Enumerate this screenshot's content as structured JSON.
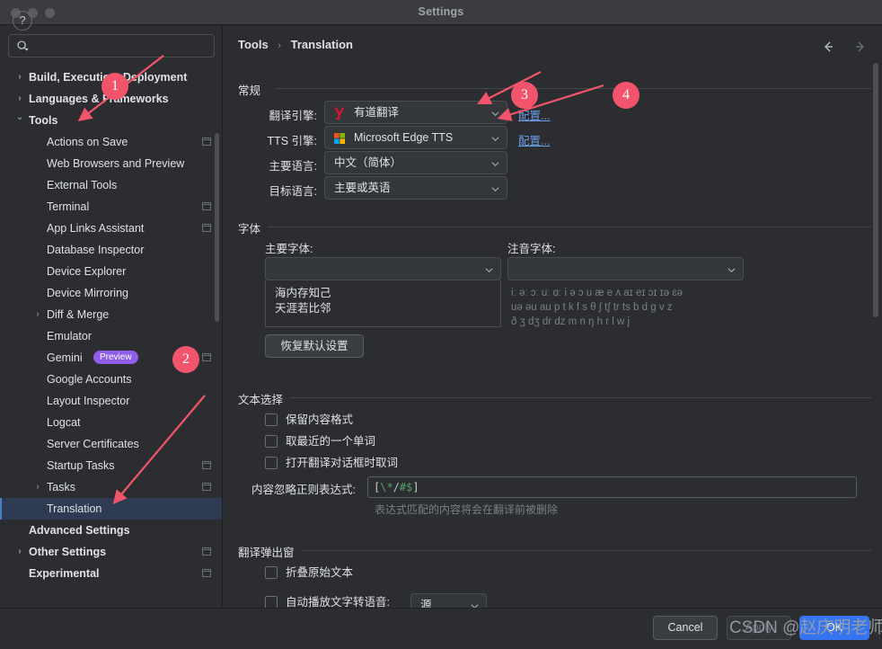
{
  "window": {
    "title": "Settings",
    "traffic_lights": [
      "close",
      "minimize",
      "maximize"
    ]
  },
  "sidebar": {
    "search": {
      "value": "",
      "placeholder": "",
      "icon": "search-icon"
    },
    "items": [
      {
        "label": "Build, Execution, Deployment",
        "level": 0,
        "bold": true,
        "arrow": "collapsed",
        "modified": false,
        "selected": false
      },
      {
        "label": "Languages & Frameworks",
        "level": 0,
        "bold": true,
        "arrow": "collapsed",
        "modified": false,
        "selected": false
      },
      {
        "label": "Tools",
        "level": 0,
        "bold": true,
        "arrow": "expanded",
        "modified": false,
        "selected": false
      },
      {
        "label": "Actions on Save",
        "level": 1,
        "bold": false,
        "arrow": "none",
        "modified": true,
        "selected": false
      },
      {
        "label": "Web Browsers and Preview",
        "level": 1,
        "bold": false,
        "arrow": "none",
        "modified": false,
        "selected": false
      },
      {
        "label": "External Tools",
        "level": 1,
        "bold": false,
        "arrow": "none",
        "modified": false,
        "selected": false
      },
      {
        "label": "Terminal",
        "level": 1,
        "bold": false,
        "arrow": "none",
        "modified": true,
        "selected": false
      },
      {
        "label": "App Links Assistant",
        "level": 1,
        "bold": false,
        "arrow": "none",
        "modified": true,
        "selected": false
      },
      {
        "label": "Database Inspector",
        "level": 1,
        "bold": false,
        "arrow": "none",
        "modified": false,
        "selected": false
      },
      {
        "label": "Device Explorer",
        "level": 1,
        "bold": false,
        "arrow": "none",
        "modified": false,
        "selected": false
      },
      {
        "label": "Device Mirroring",
        "level": 1,
        "bold": false,
        "arrow": "none",
        "modified": false,
        "selected": false
      },
      {
        "label": "Diff & Merge",
        "level": 1,
        "bold": false,
        "arrow": "collapsed",
        "modified": false,
        "selected": false
      },
      {
        "label": "Emulator",
        "level": 1,
        "bold": false,
        "arrow": "none",
        "modified": false,
        "selected": false
      },
      {
        "label": "Gemini",
        "level": 1,
        "bold": false,
        "arrow": "none",
        "modified": true,
        "selected": false,
        "tag": "Preview"
      },
      {
        "label": "Google Accounts",
        "level": 1,
        "bold": false,
        "arrow": "none",
        "modified": false,
        "selected": false
      },
      {
        "label": "Layout Inspector",
        "level": 1,
        "bold": false,
        "arrow": "none",
        "modified": false,
        "selected": false
      },
      {
        "label": "Logcat",
        "level": 1,
        "bold": false,
        "arrow": "none",
        "modified": false,
        "selected": false
      },
      {
        "label": "Server Certificates",
        "level": 1,
        "bold": false,
        "arrow": "none",
        "modified": false,
        "selected": false
      },
      {
        "label": "Startup Tasks",
        "level": 1,
        "bold": false,
        "arrow": "none",
        "modified": true,
        "selected": false
      },
      {
        "label": "Tasks",
        "level": 1,
        "bold": false,
        "arrow": "collapsed",
        "modified": true,
        "selected": false
      },
      {
        "label": "Translation",
        "level": 1,
        "bold": false,
        "arrow": "none",
        "modified": false,
        "selected": true
      },
      {
        "label": "Advanced Settings",
        "level": 0,
        "bold": true,
        "arrow": "none",
        "modified": false,
        "selected": false
      },
      {
        "label": "Other Settings",
        "level": 0,
        "bold": true,
        "arrow": "collapsed",
        "modified": true,
        "selected": false
      },
      {
        "label": "Experimental",
        "level": 0,
        "bold": true,
        "arrow": "none",
        "modified": true,
        "selected": false
      }
    ]
  },
  "breadcrumb": {
    "root": "Tools",
    "separator": "›",
    "current": "Translation"
  },
  "nav": {
    "back": "back-arrow",
    "forward": "forward-arrow"
  },
  "general": {
    "section_title": "常规",
    "translate_engine": {
      "label": "翻译引擎:",
      "value": "有道翻译",
      "icon": "youdao-logo-icon",
      "configure_link": "配置..."
    },
    "tts_engine": {
      "label": "TTS 引擎:",
      "value": "Microsoft Edge TTS",
      "icon": "microsoft-logo-icon",
      "configure_link": "配置..."
    },
    "primary_language": {
      "label": "主要语言:",
      "value": "中文（简体）"
    },
    "target_language": {
      "label": "目标语言:",
      "value": "主要或英语"
    }
  },
  "fonts": {
    "section_title": "字体",
    "primary_font": {
      "label": "主要字体:",
      "value": ""
    },
    "phonetic_font": {
      "label": "注音字体:",
      "value": ""
    },
    "primary_preview_line1": "海内存知己",
    "primary_preview_line2": "天涯若比邻",
    "phonetic_preview_line1": "iː əː ɔː uː ɑː i ə ɔ u æ e ʌ aɪ eɪ ɔɪ ɪə ɛə",
    "phonetic_preview_line2": "uə əu au p t k f s θ ∫ t∫ tr ts b d g v z",
    "phonetic_preview_line3": "ð ʒ dʒ dr dz m n ŋ h r l w j",
    "restore_defaults_button": "恢复默认设置"
  },
  "text_selection": {
    "section_title": "文本选择",
    "checkboxes": [
      {
        "label": "保留内容格式",
        "checked": false
      },
      {
        "label": "取最近的一个单词",
        "checked": false
      },
      {
        "label": "打开翻译对话框时取词",
        "checked": false
      }
    ],
    "regex_label": "内容忽略正则表达式:",
    "regex_value": "[\\*/#$]",
    "regex_hint": "表达式匹配的内容将会在翻译前被删除"
  },
  "popup": {
    "section_title": "翻译弹出窗",
    "fold_original": {
      "label": "折叠原始文本",
      "checked": false
    },
    "auto_tts": {
      "label": "自动播放文字转语音:",
      "checked": false,
      "value": "源"
    }
  },
  "footer": {
    "help_label": "?",
    "cancel": "Cancel",
    "apply": "Apply",
    "ok": "OK"
  },
  "annotations": {
    "badges": [
      "1",
      "2",
      "3",
      "4"
    ],
    "badge_color": "#f2556b",
    "watermark": "CSDN @赵庆明老师"
  }
}
